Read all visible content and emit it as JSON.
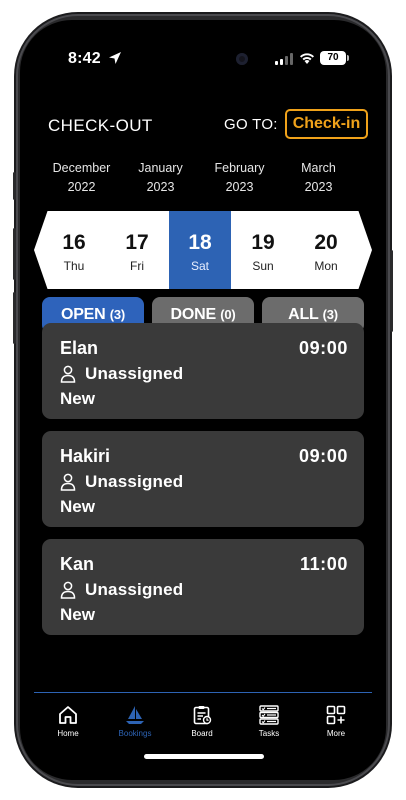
{
  "status_bar": {
    "time": "8:42",
    "battery": "70"
  },
  "header": {
    "title": "CHECK-OUT",
    "goto_label": "GO TO:",
    "checkin_button": "Check-in"
  },
  "months": [
    {
      "name": "December",
      "year": "2022"
    },
    {
      "name": "January",
      "year": "2023"
    },
    {
      "name": "February",
      "year": "2023"
    },
    {
      "name": "March",
      "year": "2023"
    }
  ],
  "days": [
    {
      "num": "16",
      "dow": "Thu"
    },
    {
      "num": "17",
      "dow": "Fri"
    },
    {
      "num": "18",
      "dow": "Sat",
      "selected": true
    },
    {
      "num": "19",
      "dow": "Sun"
    },
    {
      "num": "20",
      "dow": "Mon"
    }
  ],
  "filters": {
    "open": {
      "label": "OPEN",
      "count": "(3)"
    },
    "done": {
      "label": "DONE",
      "count": "(0)"
    },
    "all": {
      "label": "ALL",
      "count": "(3)"
    }
  },
  "bookings": [
    {
      "name": "Elan",
      "time": "09:00",
      "assignee": "Unassigned",
      "status": "New"
    },
    {
      "name": "Hakiri",
      "time": "09:00",
      "assignee": "Unassigned",
      "status": "New"
    },
    {
      "name": "Kan",
      "time": "11:00",
      "assignee": "Unassigned",
      "status": "New"
    }
  ],
  "tabbar": {
    "home": "Home",
    "bookings": "Bookings",
    "board": "Board",
    "tasks": "Tasks",
    "more": "More"
  },
  "colors": {
    "accent": "#2d63b4",
    "checkin": "#f0a21a",
    "card": "#3a3a3a",
    "filter_inactive": "#6c6c6c"
  }
}
